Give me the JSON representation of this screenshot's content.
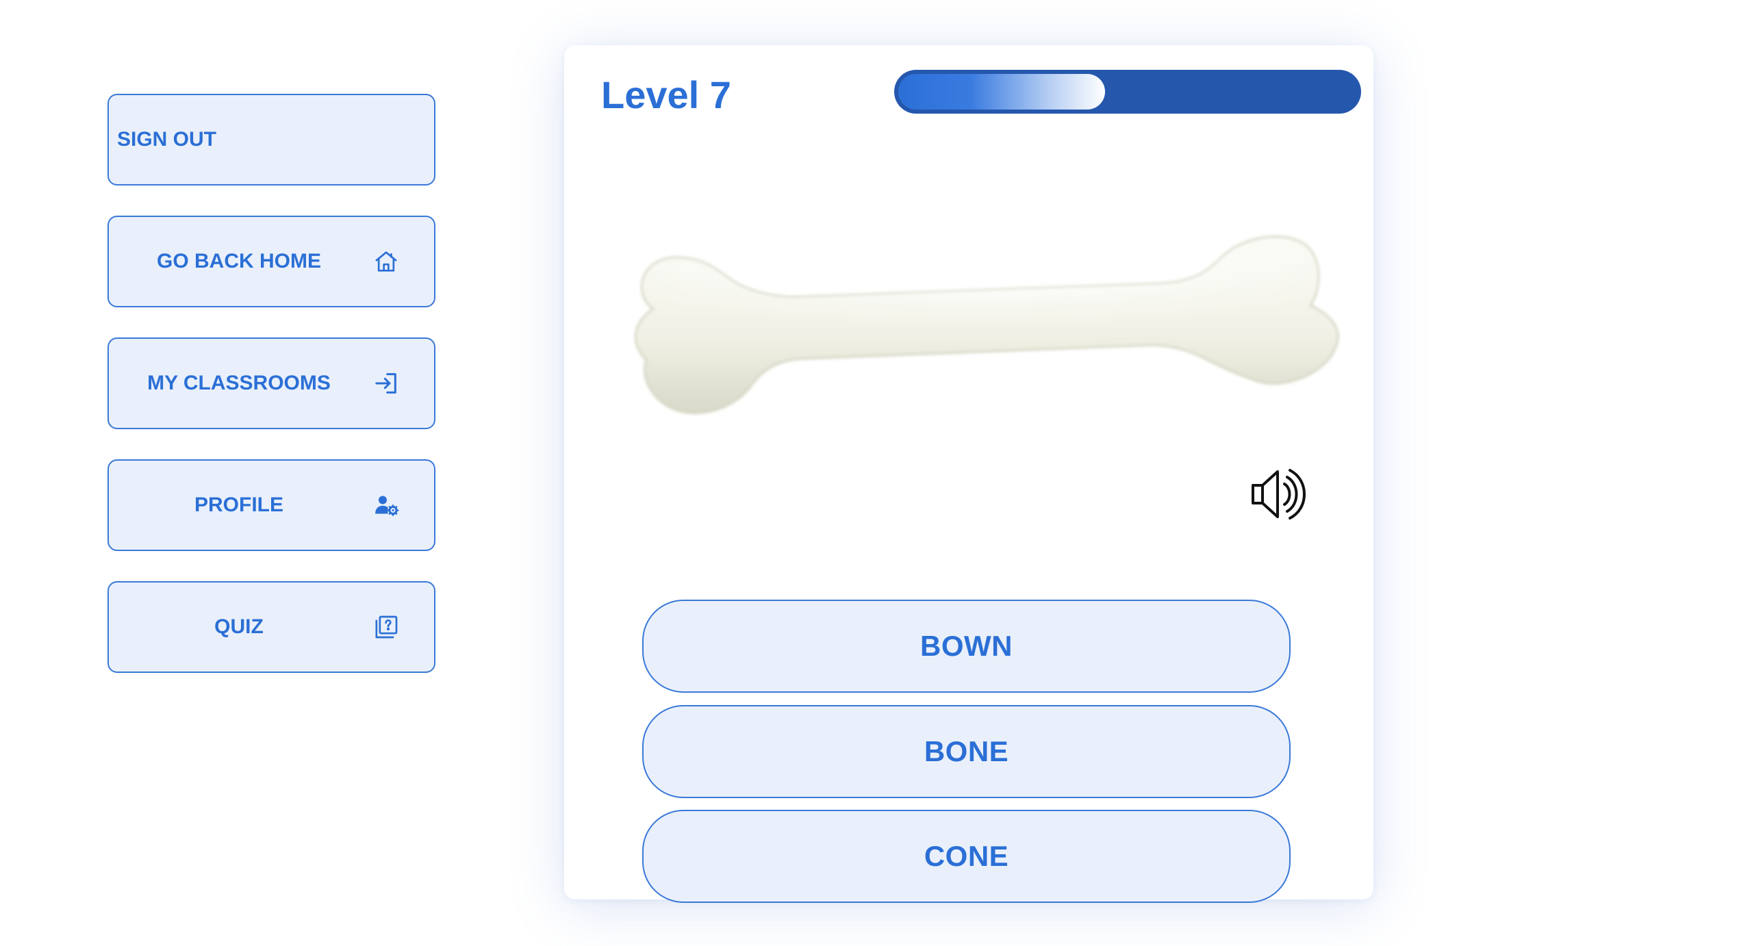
{
  "sidebar": {
    "items": [
      {
        "label": "SIGN OUT",
        "icon": ""
      },
      {
        "label": "GO BACK HOME",
        "icon": "home-icon"
      },
      {
        "label": "MY CLASSROOMS",
        "icon": "login-icon"
      },
      {
        "label": "PROFILE",
        "icon": "user-settings-icon"
      },
      {
        "label": "QUIZ",
        "icon": "quiz-icon"
      }
    ]
  },
  "quiz": {
    "level_label": "Level 7",
    "progress": 0.45,
    "image": "bone-image",
    "speaker_icon": "speaker-icon",
    "options": [
      "BOWN",
      "BONE",
      "CONE"
    ]
  },
  "colors": {
    "accent": "#2b6fd6",
    "button_bg": "#e9f0fb",
    "progress_track": "#2557ad"
  }
}
